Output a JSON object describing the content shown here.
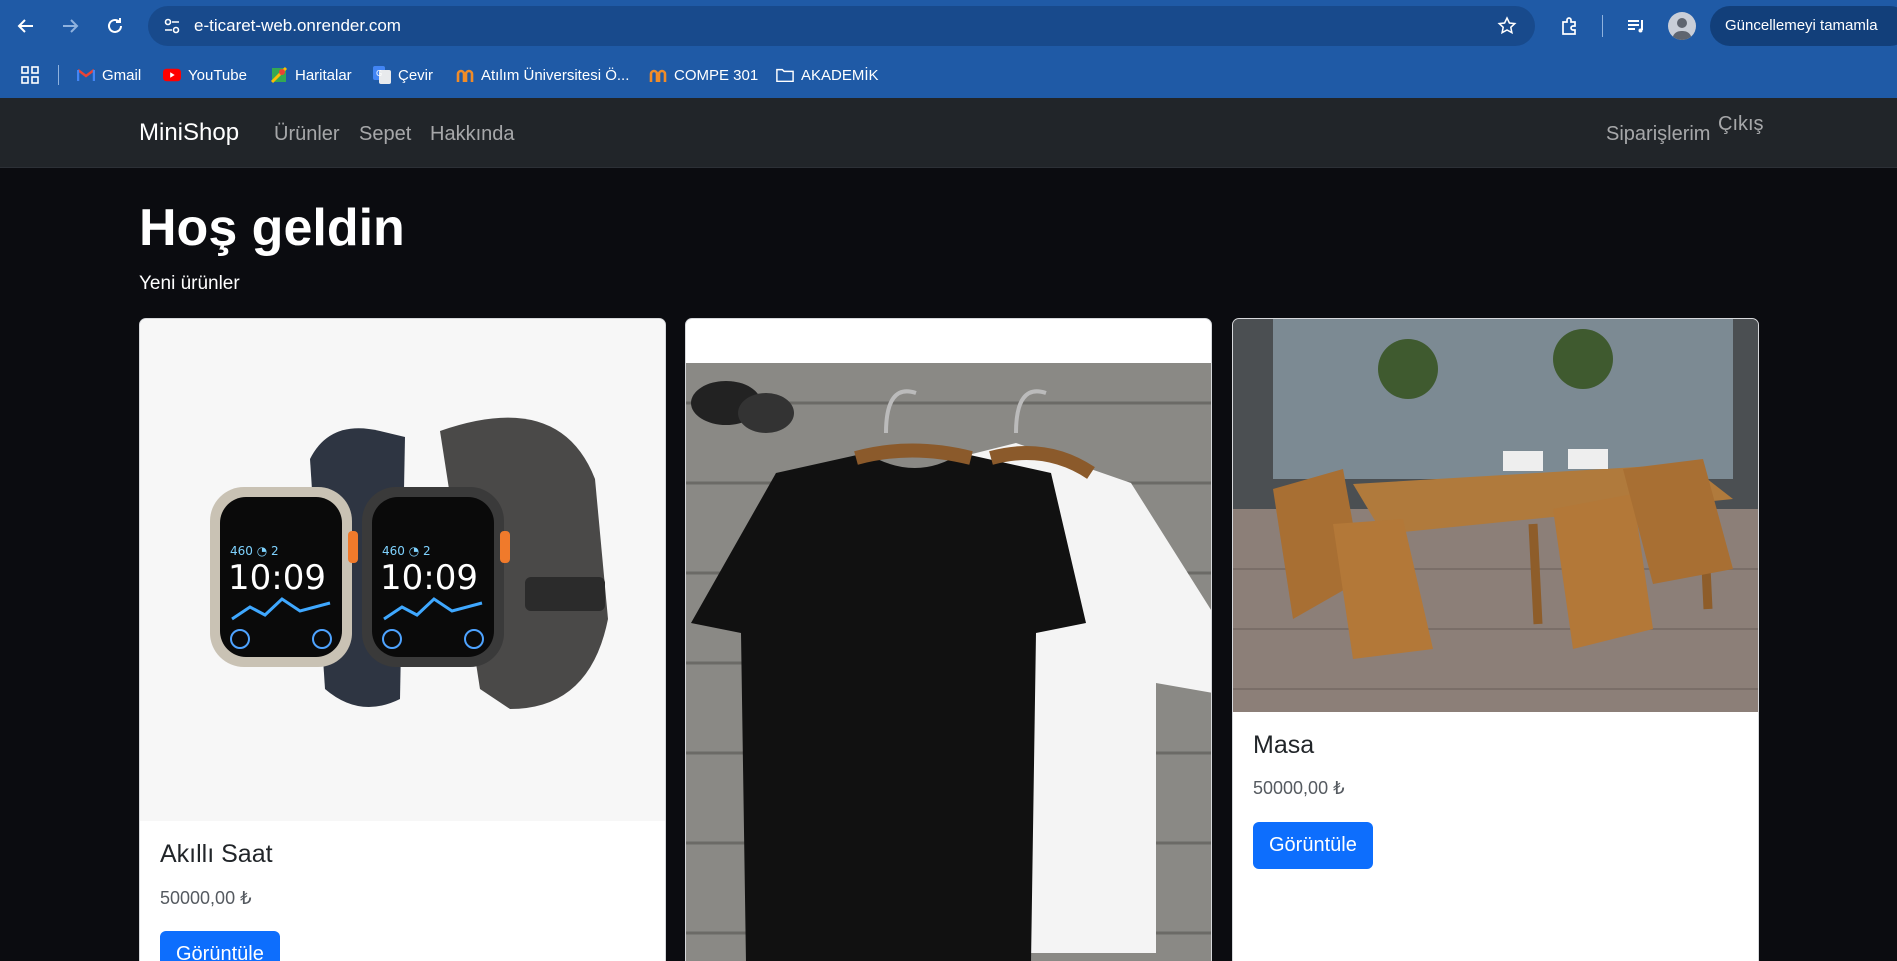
{
  "browser": {
    "url": "e-ticaret-web.onrender.com",
    "update_button": "Güncellemeyi tamamla",
    "bookmarks": [
      {
        "label": "Gmail",
        "icon": "gmail-icon"
      },
      {
        "label": "YouTube",
        "icon": "youtube-icon"
      },
      {
        "label": "Haritalar",
        "icon": "maps-icon"
      },
      {
        "label": "Çevir",
        "icon": "translate-icon"
      },
      {
        "label": "Atılım Üniversitesi Ö...",
        "icon": "atilim-icon"
      },
      {
        "label": "COMPE 301",
        "icon": "atilim-icon"
      },
      {
        "label": "AKADEMİK",
        "icon": "folder-icon"
      }
    ]
  },
  "site": {
    "brand": "MiniShop",
    "nav": [
      "Ürünler",
      "Sepet",
      "Hakkında"
    ],
    "nav_right": [
      "Siparişlerim",
      "Çıkış"
    ]
  },
  "main": {
    "title": "Hoş geldin",
    "subtitle": "Yeni ürünler",
    "products": [
      {
        "name": "Akıllı Saat",
        "price": "50000,00 ₺",
        "button": "Görüntüle",
        "image": "smartwatch-image"
      },
      {
        "name": "",
        "price": "",
        "button": "",
        "image": "tshirt-image"
      },
      {
        "name": "Masa",
        "price": "50000,00 ₺",
        "button": "Görüntüle",
        "image": "table-image"
      }
    ]
  },
  "colors": {
    "browser_bar": "#1f5aa6",
    "navbar": "#212529",
    "page_bg": "#0b0c10",
    "primary_button": "#0d6efd"
  }
}
